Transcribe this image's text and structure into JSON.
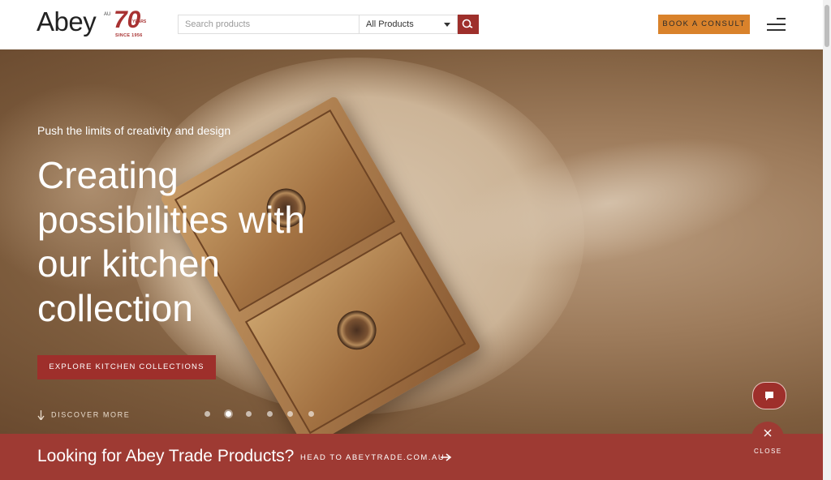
{
  "header": {
    "logo_text": "Abey",
    "logo_au": "AU",
    "logo_70": "70",
    "logo_years": "YEARS",
    "logo_since": "SINCE 1956",
    "search_placeholder": "Search products",
    "category_selected": "All Products",
    "book_label": "BOOK A CONSULT"
  },
  "hero": {
    "subtitle": "Push the limits of creativity and design",
    "headline": "Creating possibilities with our kitchen collection",
    "cta_label": "EXPLORE KITCHEN COLLECTIONS",
    "discover_label": "DISCOVER MORE",
    "slide_count": 6,
    "active_slide": 2
  },
  "banner": {
    "title": "Looking for Abey Trade Products?",
    "link_label": "HEAD TO ABEYTRADE.COM.AU",
    "close_label": "CLOSE"
  },
  "colors": {
    "brand_red": "#9e2f2b",
    "consult_orange": "#d9822b"
  }
}
